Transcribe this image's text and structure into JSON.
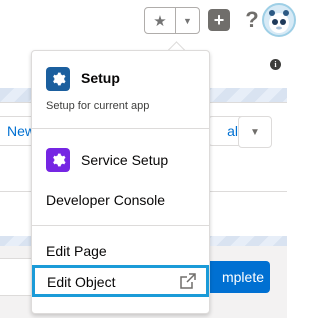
{
  "header": {
    "favorites_icon": "star-icon",
    "favorites_menu_icon": "chevron-down-icon",
    "add_icon": "plus-icon",
    "help_icon": "question-icon",
    "setup_icon": "gear-icon",
    "help_glyph": "?",
    "star_glyph": "★",
    "caret_glyph": "▼",
    "plus_glyph": "+"
  },
  "background": {
    "new_button_label": "New",
    "al_button_label": "al",
    "complete_button_label": "mplete",
    "info_glyph": "i",
    "more_glyph": "▼"
  },
  "setup_menu": {
    "setup": {
      "title": "Setup",
      "subtitle": "Setup for current app",
      "icon": "gear-icon"
    },
    "service_setup": {
      "label": "Service Setup",
      "icon": "gear-icon"
    },
    "developer_console": {
      "label": "Developer Console"
    },
    "edit_page": {
      "label": "Edit Page"
    },
    "edit_object": {
      "label": "Edit Object",
      "icon": "external-link-icon"
    }
  },
  "colors": {
    "setup_icon_bg": "#1b5f9e",
    "service_icon_bg": "#7526e3",
    "highlight_border": "#1b9bd8",
    "brand_button": "#0070d2"
  }
}
